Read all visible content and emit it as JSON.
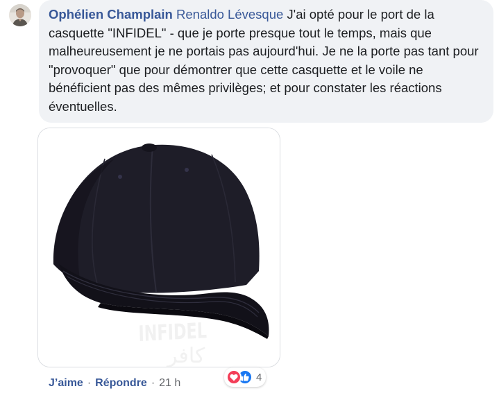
{
  "comment": {
    "author": "Ophélien Champlain",
    "mention": "Renaldo Lévesque",
    "text": " J'ai opté pour le port de la casquette \"INFIDEL\" - que je porte presque tout le temps, mais que malheureusement je ne portais pas aujourd'hui. Je ne la porte pas tant pour \"provoquer\" que pour démontrer que cette casquette et le voile ne bénéficient pas des mêmes privilèges; et pour constater les réactions éventuelles."
  },
  "attachment": {
    "cap_text_latin": "INFIDEL",
    "cap_text_arabic": "كافر"
  },
  "actions": {
    "like_label": "J’aime",
    "reply_label": "Répondre",
    "separator": "·",
    "timestamp": "21 h"
  },
  "reactions": {
    "icons": [
      "love-icon",
      "like-icon"
    ],
    "count": "4",
    "colors": {
      "love": "#f33e58",
      "like": "#1877f2"
    }
  },
  "colors": {
    "link": "#385898",
    "bubble_bg": "#f0f2f5",
    "meta_text": "#65676b"
  }
}
